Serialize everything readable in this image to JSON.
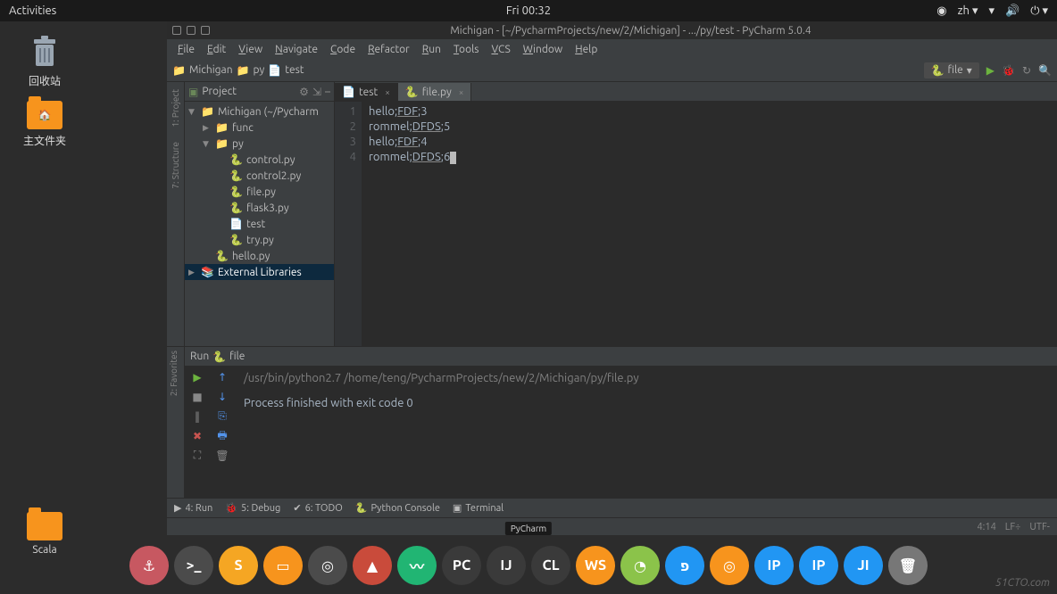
{
  "topbar": {
    "activities": "Activities",
    "clock": "Fri 00:32",
    "lang": "zh"
  },
  "desktop": {
    "trash": "回收站",
    "home": "主文件夹",
    "scala": "Scala"
  },
  "ide": {
    "title": "Michigan - [~/PycharmProjects/new/2/Michigan] - .../py/test - PyCharm 5.0.4",
    "menu": [
      "File",
      "Edit",
      "View",
      "Navigate",
      "Code",
      "Refactor",
      "Run",
      "Tools",
      "VCS",
      "Window",
      "Help"
    ],
    "breadcrumbs": [
      "Michigan",
      "py",
      "test"
    ],
    "run_config": "file",
    "project_panel_title": "Project",
    "tree": [
      {
        "d": 0,
        "ar": "▼",
        "ico": "folder",
        "label": "Michigan",
        "suffix": " (~/Pycharm",
        "sel": false
      },
      {
        "d": 1,
        "ar": "▶",
        "ico": "folder",
        "label": "func"
      },
      {
        "d": 1,
        "ar": "▼",
        "ico": "folder",
        "label": "py"
      },
      {
        "d": 2,
        "ar": "",
        "ico": "py",
        "label": "control.py"
      },
      {
        "d": 2,
        "ar": "",
        "ico": "py",
        "label": "control2.py"
      },
      {
        "d": 2,
        "ar": "",
        "ico": "py",
        "label": "file.py"
      },
      {
        "d": 2,
        "ar": "",
        "ico": "py",
        "label": "flask3.py"
      },
      {
        "d": 2,
        "ar": "",
        "ico": "file",
        "label": "test"
      },
      {
        "d": 2,
        "ar": "",
        "ico": "py",
        "label": "try.py"
      },
      {
        "d": 1,
        "ar": "",
        "ico": "py",
        "label": "hello.py"
      },
      {
        "d": 0,
        "ar": "▶",
        "ico": "lib",
        "label": "External Libraries",
        "sel": true
      }
    ],
    "tabs": [
      {
        "label": "test",
        "icon": "file",
        "active": true
      },
      {
        "label": "file.py",
        "icon": "py",
        "active": false
      }
    ],
    "editor_lines": [
      "hello;FDF;3",
      "rommel;DFDS;5",
      "hello;FDF;4",
      "rommel;DFDS;6"
    ],
    "run_panel": {
      "title": "Run",
      "config": "file",
      "command": "/usr/bin/python2.7 /home/teng/PycharmProjects/new/2/Michigan/py/file.py",
      "result": "Process finished with exit code 0"
    },
    "bottom_tabs": [
      {
        "icon": "▶",
        "label": "4: Run"
      },
      {
        "icon": "🐞",
        "label": "5: Debug"
      },
      {
        "icon": "✔",
        "label": "6: TODO"
      },
      {
        "icon": "🐍",
        "label": "Python Console"
      },
      {
        "icon": "▣",
        "label": "Terminal"
      }
    ],
    "status": {
      "pos": "4:14",
      "lf": "LF÷",
      "enc": "UTF-"
    },
    "side_tabs": {
      "project": "1: Project",
      "structure": "7: Structure",
      "favorites": "2: Favorites"
    }
  },
  "dock_tooltip": "PyCharm",
  "dock": [
    {
      "bg": "#c75861",
      "txt": "⚓"
    },
    {
      "bg": "#4b4b4b",
      "txt": ">_"
    },
    {
      "bg": "#f5a623",
      "txt": "S"
    },
    {
      "bg": "#f7941d",
      "txt": "▭"
    },
    {
      "bg": "#4b4b4b",
      "txt": "◎"
    },
    {
      "bg": "#c94b3b",
      "txt": "▲"
    },
    {
      "bg": "#21b573",
      "txt": "〰"
    },
    {
      "bg": "#3a3a3a",
      "txt": "PC"
    },
    {
      "bg": "#3a3a3a",
      "txt": "IJ"
    },
    {
      "bg": "#3a3a3a",
      "txt": "CL"
    },
    {
      "bg": "#f7941d",
      "txt": "WS"
    },
    {
      "bg": "#8bc34a",
      "txt": "◔"
    },
    {
      "bg": "#2196f3",
      "txt": "פ"
    },
    {
      "bg": "#f7941d",
      "txt": "◎"
    },
    {
      "bg": "#2196f3",
      "txt": "IP"
    },
    {
      "bg": "#2196f3",
      "txt": "IP"
    },
    {
      "bg": "#2196f3",
      "txt": "JI"
    },
    {
      "bg": "#777",
      "txt": "🗑"
    }
  ],
  "watermark": "51CTO.com"
}
